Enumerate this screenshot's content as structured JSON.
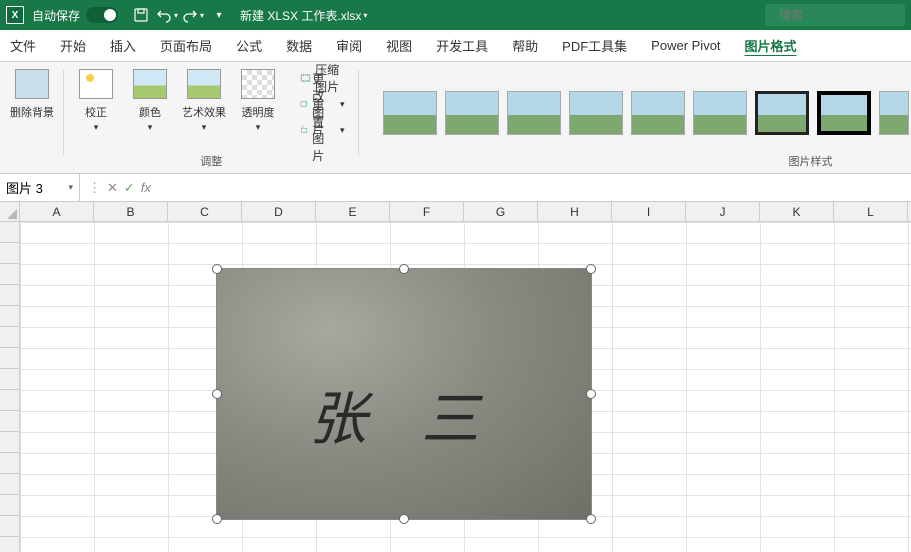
{
  "titlebar": {
    "autosave_label": "自动保存",
    "autosave_state": "关",
    "filename": "新建 XLSX 工作表.xlsx"
  },
  "search": {
    "placeholder": "搜索"
  },
  "tabs": [
    "文件",
    "开始",
    "插入",
    "页面布局",
    "公式",
    "数据",
    "审阅",
    "视图",
    "开发工具",
    "帮助",
    "PDF工具集",
    "Power Pivot",
    "图片格式"
  ],
  "active_tab": "图片格式",
  "ribbon": {
    "remove_bg": "删除背景",
    "corrections": "校正",
    "color": "颜色",
    "artistic": "艺术效果",
    "transparency": "透明度",
    "adjust_label": "调整",
    "compress": "压缩图片",
    "change": "更改图片",
    "reset": "重置图片",
    "styles_label": "图片样式"
  },
  "namebox": {
    "value": "图片 3"
  },
  "formula": {
    "fx": "fx",
    "value": ""
  },
  "columns": [
    "A",
    "B",
    "C",
    "D",
    "E",
    "F",
    "G",
    "H",
    "I",
    "J",
    "K",
    "L"
  ],
  "image_text": "张 三"
}
